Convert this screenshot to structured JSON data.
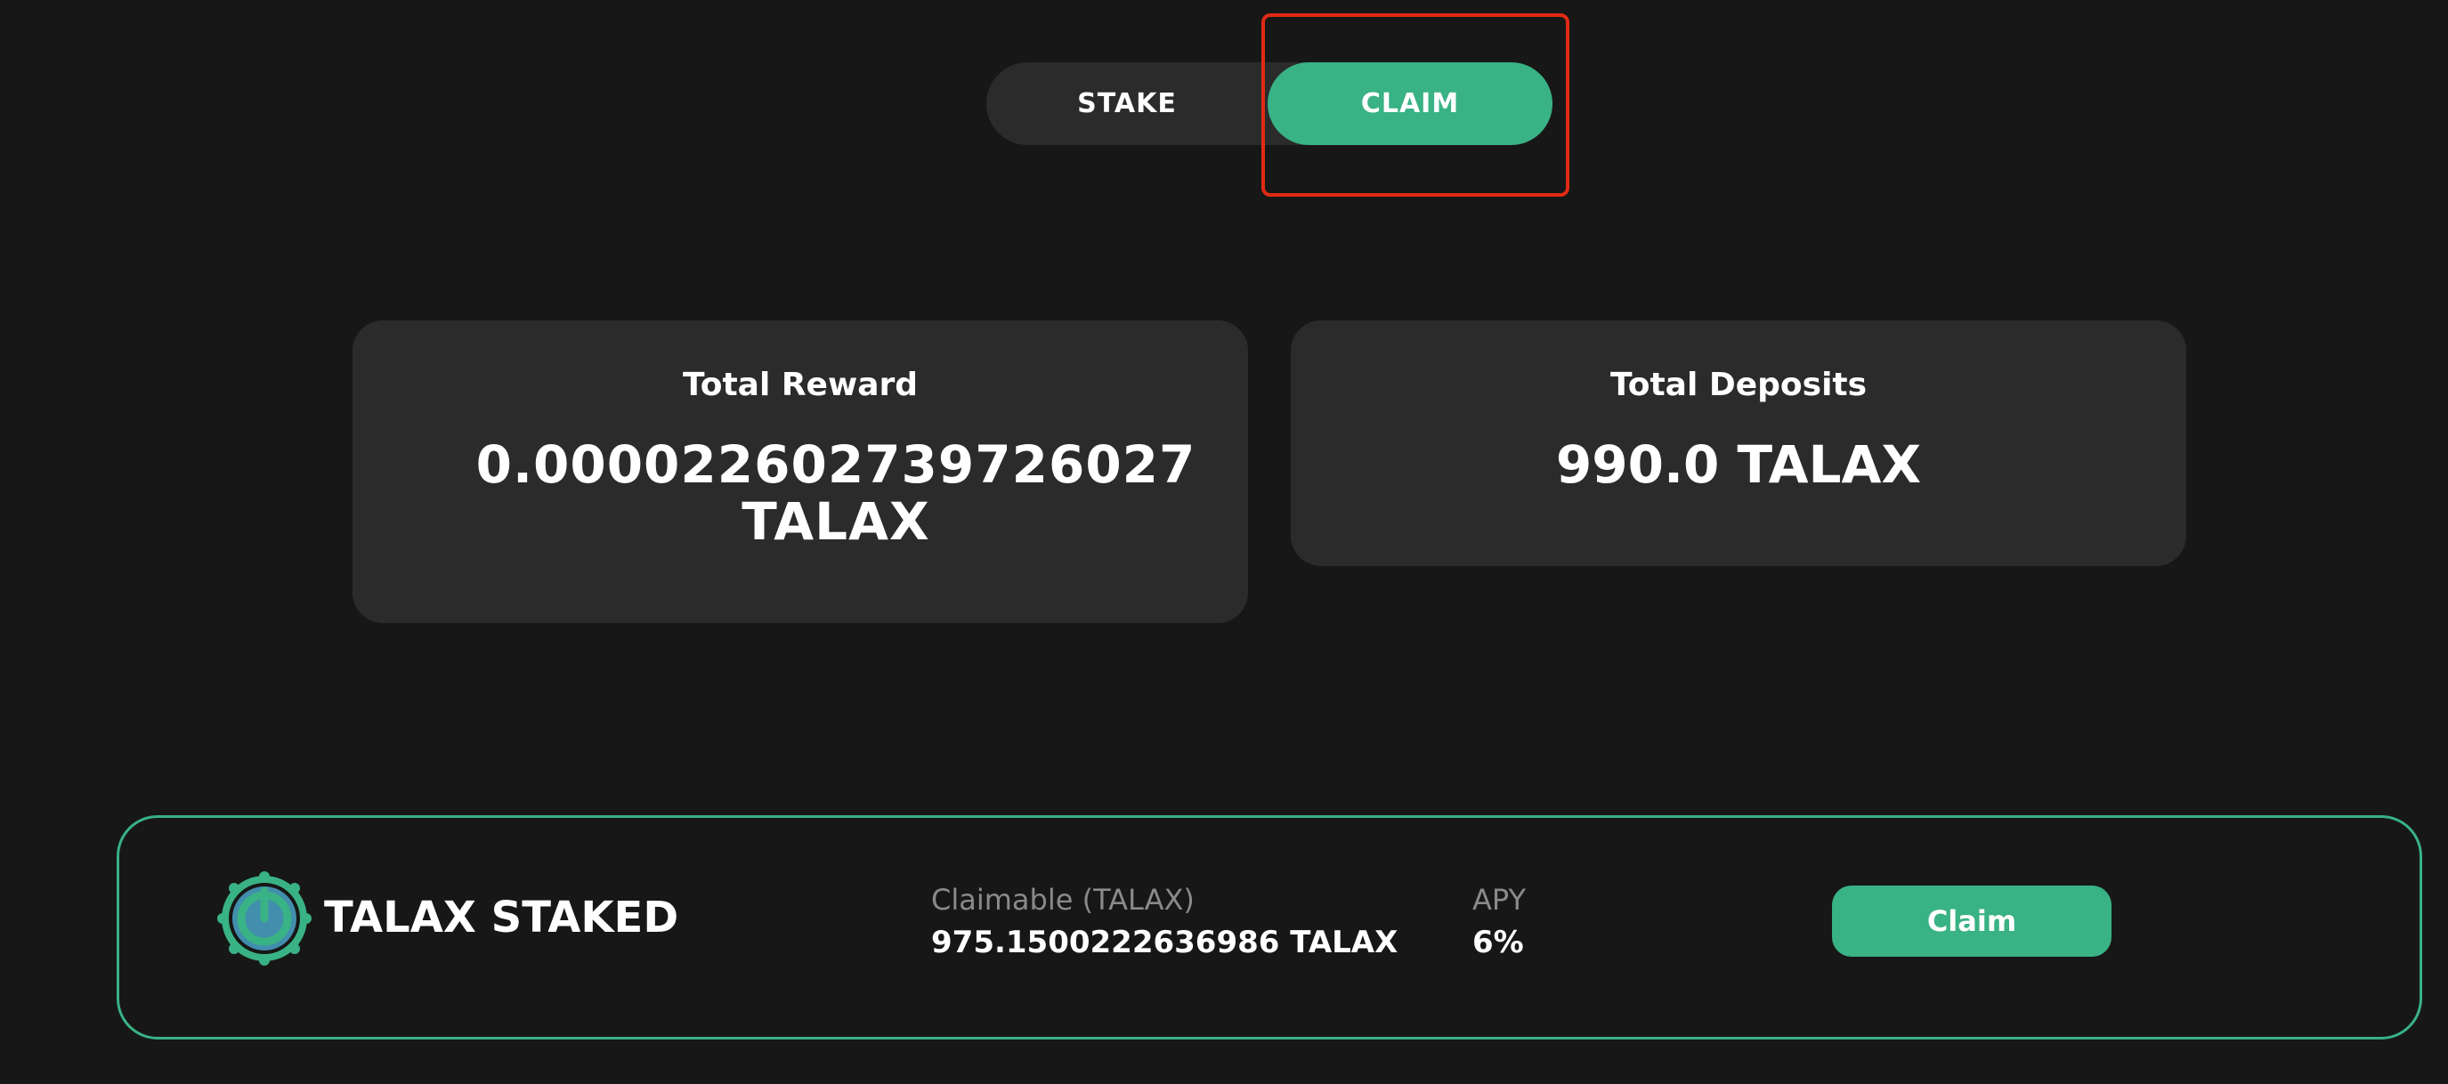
{
  "tabs": {
    "stake_label": "STAKE",
    "claim_label": "CLAIM",
    "active": "CLAIM"
  },
  "cards": {
    "total_reward": {
      "title": "Total Reward",
      "value": "0.000022602739726027 TALAX"
    },
    "total_deposits": {
      "title": "Total Deposits",
      "value": "990.0 TALAX"
    }
  },
  "staked_panel": {
    "title": "TALAX STAKED",
    "logo_icon": "talax-logo-icon",
    "claimable_label": "Claimable (TALAX)",
    "claimable_value": "975.1500222636986 TALAX",
    "apy_label": "APY",
    "apy_value": "6%",
    "claim_button_label": "Claim"
  },
  "colors": {
    "background": "#171717",
    "card": "#2b2b2b",
    "accent": "#39b285",
    "highlight": "#e02a14",
    "muted_text": "#8a8a8a"
  }
}
